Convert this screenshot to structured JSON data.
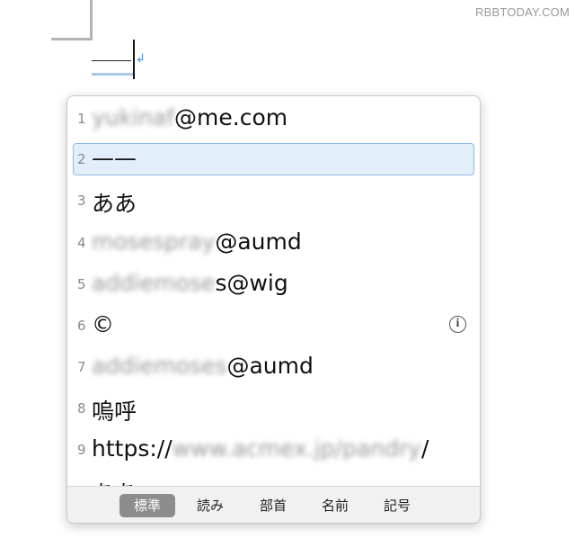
{
  "watermark": "RBBTODAY.COM",
  "document": {
    "typed_text": "——",
    "return_mark": "↲"
  },
  "candidates": [
    {
      "number": "1",
      "blurred": "yukinaf",
      "text": "@me.com"
    },
    {
      "number": "2",
      "blurred": "",
      "text": "——"
    },
    {
      "number": "3",
      "blurred": "",
      "text": "ああ"
    },
    {
      "number": "4",
      "blurred": "mosespray",
      "text": "@aumd"
    },
    {
      "number": "5",
      "blurred": "addiemose",
      "text": "s@wig"
    },
    {
      "number": "6",
      "blurred": "",
      "text": "©"
    },
    {
      "number": "7",
      "blurred": "addiemoses",
      "text": "@aumd"
    },
    {
      "number": "8",
      "blurred": "",
      "text": "嗚呼"
    },
    {
      "number": "9",
      "prefix": "https://",
      "blurred": "www.acmex.jp/pandry",
      "text": "/"
    },
    {
      "number": "",
      "blurred": "",
      "text": "ああ"
    }
  ],
  "selected_index": 1,
  "info_icon": "ⓘ",
  "tabs": [
    {
      "label": "標準",
      "active": true
    },
    {
      "label": "読み",
      "active": false
    },
    {
      "label": "部首",
      "active": false
    },
    {
      "label": "名前",
      "active": false
    },
    {
      "label": "記号",
      "active": false
    }
  ]
}
